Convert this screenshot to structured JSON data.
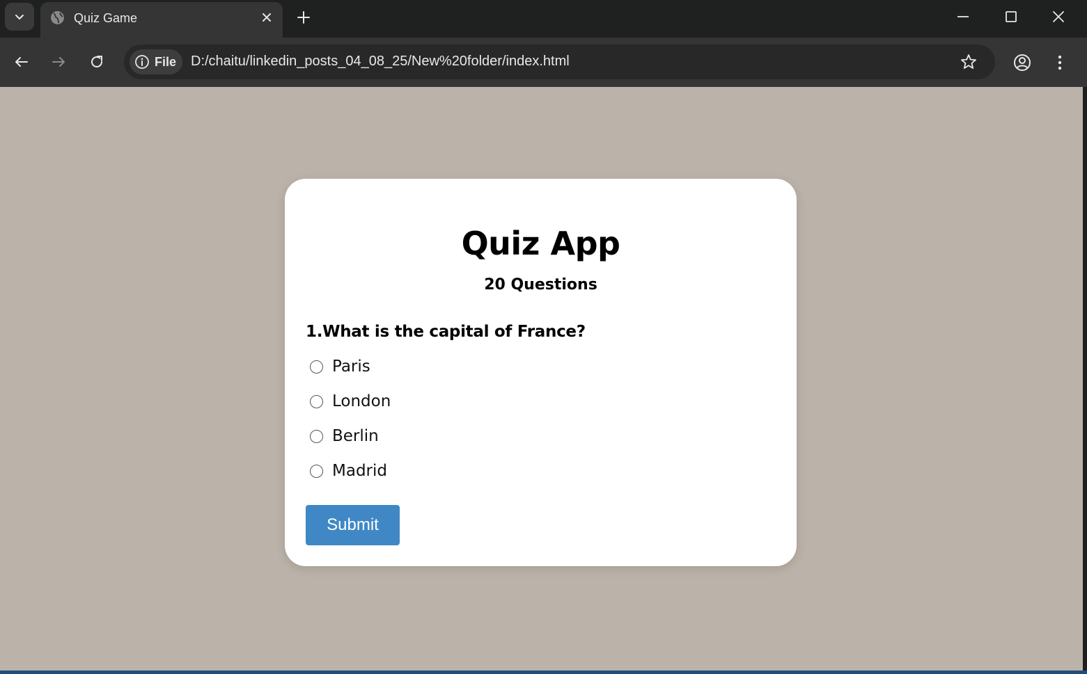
{
  "browser": {
    "tab": {
      "title": "Quiz Game"
    },
    "address_bar": {
      "site_chip_label": "File",
      "url": "D:/chaitu/linkedin_posts_04_08_25/New%20folder/index.html"
    }
  },
  "quiz": {
    "title": "Quiz App",
    "subtitle": "20 Questions",
    "question": "1.What is the capital of France?",
    "options": [
      "Paris",
      "London",
      "Berlin",
      "Madrid"
    ],
    "submit_label": "Submit"
  },
  "colors": {
    "page_background": "#bbb2a9",
    "card_background": "#ffffff",
    "submit_button": "#3f88c5"
  }
}
